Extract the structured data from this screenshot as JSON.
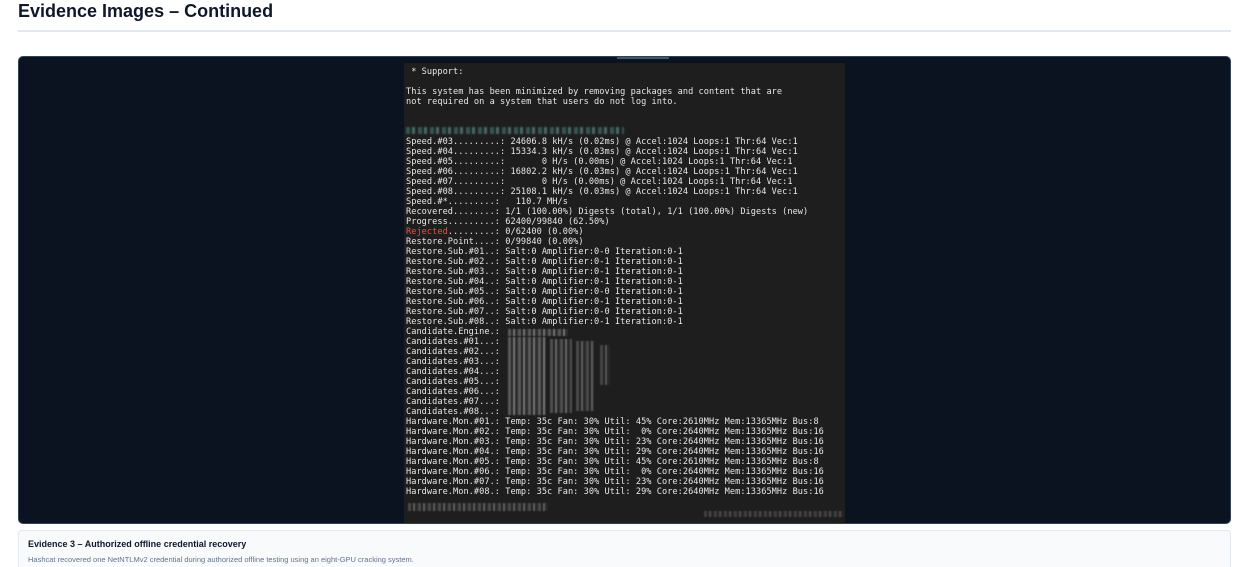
{
  "page": {
    "title": "Evidence Images – Continued"
  },
  "evidence": {
    "terminal_lines": [
      " * Support:",
      "",
      "This system has been minimized by removing packages and content that are",
      "not required on a system that users do not log into.",
      "",
      "",
      "",
      "Speed.#03.........: 24606.8 kH/s (0.02ms) @ Accel:1024 Loops:1 Thr:64 Vec:1",
      "Speed.#04.........: 15334.3 kH/s (0.03ms) @ Accel:1024 Loops:1 Thr:64 Vec:1",
      "Speed.#05.........:       0 H/s (0.00ms) @ Accel:1024 Loops:1 Thr:64 Vec:1",
      "Speed.#06.........: 16802.2 kH/s (0.03ms) @ Accel:1024 Loops:1 Thr:64 Vec:1",
      "Speed.#07.........:       0 H/s (0.00ms) @ Accel:1024 Loops:1 Thr:64 Vec:1",
      "Speed.#08.........: 25108.1 kH/s (0.03ms) @ Accel:1024 Loops:1 Thr:64 Vec:1",
      "Speed.#*.........:   110.7 MH/s",
      "Recovered........: 1/1 (100.00%) Digests (total), 1/1 (100.00%) Digests (new)",
      "Progress.........: 62400/99840 (62.50%)",
      "Rejected.........: 0/62400 (0.00%)",
      "Restore.Point....: 0/99840 (0.00%)",
      "Restore.Sub.#01..: Salt:0 Amplifier:0-0 Iteration:0-1",
      "Restore.Sub.#02..: Salt:0 Amplifier:0-1 Iteration:0-1",
      "Restore.Sub.#03..: Salt:0 Amplifier:0-1 Iteration:0-1",
      "Restore.Sub.#04..: Salt:0 Amplifier:0-1 Iteration:0-1",
      "Restore.Sub.#05..: Salt:0 Amplifier:0-0 Iteration:0-1",
      "Restore.Sub.#06..: Salt:0 Amplifier:0-1 Iteration:0-1",
      "Restore.Sub.#07..: Salt:0 Amplifier:0-0 Iteration:0-1",
      "Restore.Sub.#08..: Salt:0 Amplifier:0-1 Iteration:0-1",
      "Candidate.Engine.:",
      "Candidates.#01...:",
      "Candidates.#02...:",
      "Candidates.#03...:",
      "Candidates.#04...:",
      "Candidates.#05...:",
      "Candidates.#06...:",
      "Candidates.#07...:",
      "Candidates.#08...:",
      "Hardware.Mon.#01.: Temp: 35c Fan: 30% Util: 45% Core:2610MHz Mem:13365MHz Bus:8",
      "Hardware.Mon.#02.: Temp: 35c Fan: 30% Util:  0% Core:2640MHz Mem:13365MHz Bus:16",
      "Hardware.Mon.#03.: Temp: 35c Fan: 30% Util: 23% Core:2640MHz Mem:13365MHz Bus:16",
      "Hardware.Mon.#04.: Temp: 35c Fan: 30% Util: 29% Core:2640MHz Mem:13365MHz Bus:16",
      "Hardware.Mon.#05.: Temp: 35c Fan: 30% Util: 45% Core:2610MHz Mem:13365MHz Bus:8",
      "Hardware.Mon.#06.: Temp: 35c Fan: 30% Util:  0% Core:2640MHz Mem:13365MHz Bus:16",
      "Hardware.Mon.#07.: Temp: 35c Fan: 30% Util: 23% Core:2640MHz Mem:13365MHz Bus:16",
      "Hardware.Mon.#08.: Temp: 35c Fan: 30% Util: 29% Core:2640MHz Mem:13365MHz Bus:16"
    ],
    "highlight_word": "Rejected",
    "highlight_color": "#e05252"
  },
  "caption": {
    "title": "Evidence 3 – Authorized offline credential recovery",
    "description": "Hashcat recovered one NetNTLMv2 credential during authorized offline testing using an eight-GPU cracking system."
  }
}
